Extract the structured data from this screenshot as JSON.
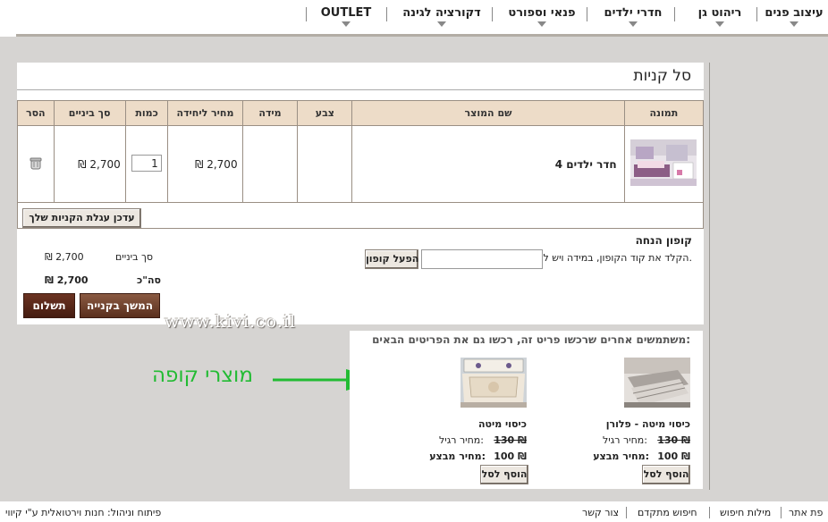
{
  "nav": {
    "items": [
      "עיצוב פנים",
      "ריהוט גן",
      "חדרי ילדים",
      "פנאי וספורט",
      "דקורציה לגינה",
      "OUTLET"
    ]
  },
  "cart": {
    "title": "סל קניות",
    "headers": {
      "image": "תמונה",
      "name": "שם המוצר",
      "color": "צבע",
      "size": "מידה",
      "unit_price": "מחיר ליחידה",
      "quantity": "כמות",
      "subtotal": "סך ביניים",
      "remove": "הסר"
    },
    "row": {
      "name": "חדר ילדים 4",
      "unit_price": "₪ 2,700",
      "quantity": "1",
      "subtotal": "₪ 2,700"
    },
    "update_button": "עדכן עגלת הקניות שלך",
    "coupon": {
      "title": "קופון הנחה",
      "hint": "הקלד את קוד הקופון, במידה ויש לך.",
      "apply_button": "הפעל קופון"
    },
    "totals": {
      "subtotal_label": "סך ביניים",
      "subtotal_value": "₪ 2,700",
      "total_label": "סה\"כ",
      "total_value": "₪ 2,700"
    },
    "continue_button": "המשך בקנייה",
    "checkout_button": "תשלום"
  },
  "watermark": "www.kivi.co.il",
  "annotation": "מוצרי קופה",
  "recommendations": {
    "title": "משתמשים אחרים שרכשו פריט זה, רכשו גם את הפריטים הבאים:",
    "products": [
      {
        "name": "כיסוי מיטה - פלורן",
        "regular_label": "מחיר רגיל:",
        "regular_price": "130 ₪",
        "sale_label": "מחיר מבצע:",
        "sale_price": "100 ₪",
        "button": "הוסף לסל"
      },
      {
        "name": "כיסוי מיטה",
        "regular_label": "מחיר רגיל:",
        "regular_price": "130 ₪",
        "sale_label": "מחיר מבצע:",
        "sale_price": "100 ₪",
        "button": "הוסף לסל"
      }
    ]
  },
  "footer": {
    "links": [
      "פת אתר",
      "מילות חיפוש",
      "חיפוש מתקדם",
      "צור קשר"
    ],
    "credit": "פיתוח וניהול: חנות וירטואלית ע\"י קיווי"
  },
  "colors": {
    "header_bg": "#eddcc8",
    "dark_button": "#5a2a18",
    "accent_green": "#22bb33",
    "gray_bg": "#d6d4d2"
  }
}
